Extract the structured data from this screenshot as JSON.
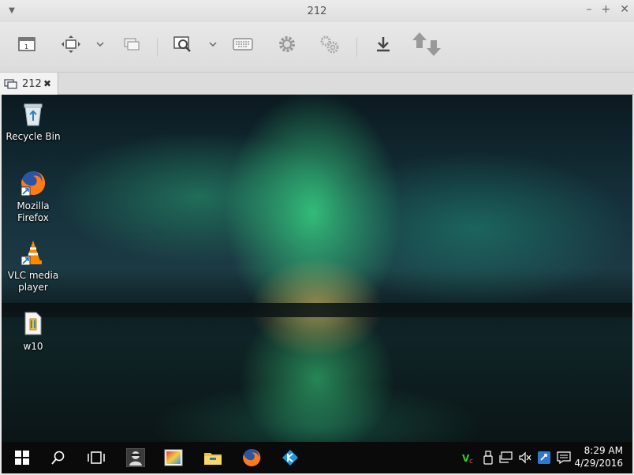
{
  "window": {
    "title": "212"
  },
  "tab": {
    "label": "212"
  },
  "desktop": {
    "icons": [
      {
        "label": "Recycle Bin"
      },
      {
        "label": "Mozilla Firefox"
      },
      {
        "label": "VLC media player"
      },
      {
        "label": "w10"
      }
    ]
  },
  "taskbar": {
    "time": "8:29 AM",
    "date": "4/29/2016"
  },
  "colors": {
    "taskbar": "#0a0a0a",
    "toolbar": "#e2e2e2",
    "firefox_orange": "#ff7b1a",
    "vlc_orange": "#ff8800",
    "kodi_blue": "#1f9ad6"
  }
}
